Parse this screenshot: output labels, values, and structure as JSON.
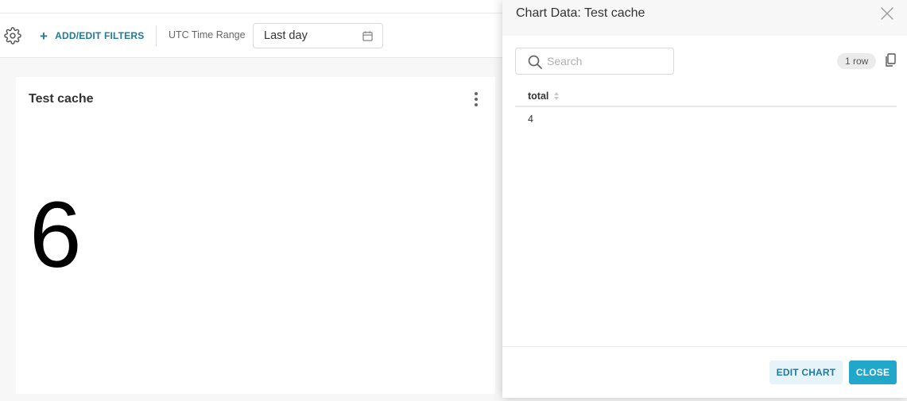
{
  "filter_bar": {
    "add_filters_label": "ADD/EDIT FILTERS",
    "time_range_label": "UTC Time Range",
    "time_range_value": "Last day"
  },
  "chart_card": {
    "title": "Test cache",
    "big_number": "6"
  },
  "modal": {
    "title": "Chart Data: Test cache",
    "search_placeholder": "Search",
    "row_count": "1 row",
    "table": {
      "columns": [
        "total"
      ],
      "rows": [
        [
          "4"
        ]
      ]
    },
    "edit_chart_label": "EDIT CHART",
    "close_label": "CLOSE"
  },
  "colors": {
    "accent": "#1f7a9e",
    "primary_button": "#20a7c9",
    "secondary_button_bg": "#e6f3f8"
  },
  "icons": {
    "settings": "gear-icon",
    "add": "plus-icon",
    "calendar": "calendar-icon",
    "more": "kebab-menu-icon",
    "close": "close-icon",
    "search": "search-icon",
    "copy": "copy-icon",
    "sort": "sort-icon"
  }
}
